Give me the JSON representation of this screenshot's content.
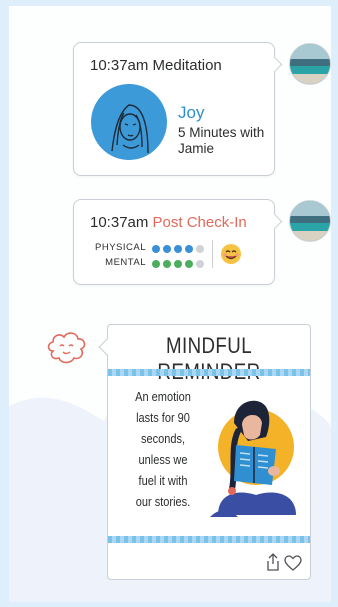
{
  "feed": {
    "meditation": {
      "time": "10:37am",
      "type": "Meditation",
      "session_title": "Joy",
      "session_detail": "5 Minutes with Jamie"
    },
    "checkin": {
      "time": "10:37am",
      "type": "Post Check-In",
      "physical_label": "PHYSICAL",
      "mental_label": "MENTAL",
      "physical_score": 4,
      "mental_score": 4,
      "max_score": 5,
      "physical_color": "#3b8fd6",
      "mental_color": "#4cae5c",
      "empty_color": "#cfd3d6",
      "mood_icon": "smiling-face-emoji-icon"
    },
    "reminder": {
      "title": "MINDFUL REMINDER",
      "quote_lines": [
        "An emotion",
        "lasts for 90",
        "seconds,",
        "unless we",
        "fuel it with",
        "our stories."
      ],
      "actions": [
        "share-icon",
        "heart-icon"
      ]
    }
  },
  "colors": {
    "accent_blue": "#2f8fd1",
    "checkin_red": "#e0695c",
    "background": "#dfeefb"
  }
}
